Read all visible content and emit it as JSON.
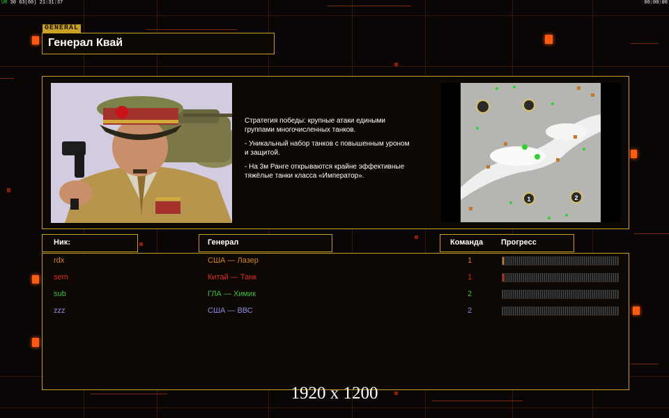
{
  "hud": {
    "left_prefix": "UR",
    "left_rest": "30 63(60) 21:31:37",
    "right_time": "00:00:00"
  },
  "general": {
    "tag": "GENERAL",
    "name": "Генерал Квай",
    "portrait_icon": "general-portrait",
    "description": [
      "Стратегия победы: крупные атаки едиными\n группами многочисленных танков.",
      "- Уникальный набор танков с повышенным уроном\n и защитой.",
      "- На 3м Ранге открываются крайне эффективные\n тяжёлые танки класса «Император»."
    ]
  },
  "map": {
    "start_positions": [
      "1",
      "2"
    ]
  },
  "table": {
    "headers": {
      "nick": "Ник:",
      "general": "Генерал",
      "team": "Команда",
      "progress": "Прогресс"
    },
    "rows": [
      {
        "nick": "rdx",
        "general": "США — Лазер",
        "team": "1",
        "progress": 0.01,
        "color": "#d9852c"
      },
      {
        "nick": "sem",
        "general": "Китай — Танк",
        "team": "1",
        "progress": 0.01,
        "color": "#e02b1f"
      },
      {
        "nick": "sub",
        "general": "ГЛА — Химик",
        "team": "2",
        "progress": 0,
        "color": "#3cbf3c"
      },
      {
        "nick": "zzz",
        "general": "США — ВВС",
        "team": "2",
        "progress": 0,
        "color": "#8c8ce0"
      }
    ]
  },
  "resolution": "1920 x 1200",
  "colors": {
    "accent": "#c9a125",
    "glow": "#ff5a12"
  }
}
